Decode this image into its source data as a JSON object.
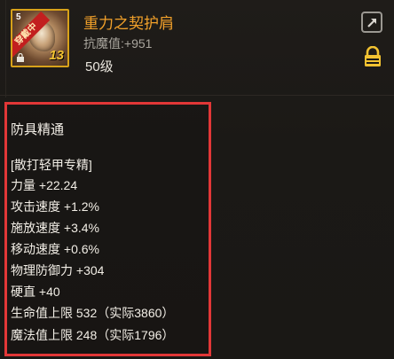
{
  "item": {
    "name": "重力之契护肩",
    "icon_badge": "穿戴中",
    "icon_corner": "5",
    "enhance_level": "13",
    "resist_label": "抗魔值",
    "resist_value": ":+951",
    "level": "50级"
  },
  "stats": {
    "title": "防具精通",
    "lines": [
      "[散打轻甲专精]",
      "力量 +22.24",
      "攻击速度 +1.2%",
      "施放速度 +3.4%",
      "移动速度 +0.6%",
      "物理防御力 +304",
      "硬直 +40",
      "生命值上限 532（实际3860）",
      "魔法值上限 248（实际1796）"
    ]
  },
  "colors": {
    "item_name": "#f2a12a",
    "highlight_border": "#e23737",
    "lock": "#f2c231"
  },
  "icons": [
    "share-icon",
    "lock-icon"
  ]
}
